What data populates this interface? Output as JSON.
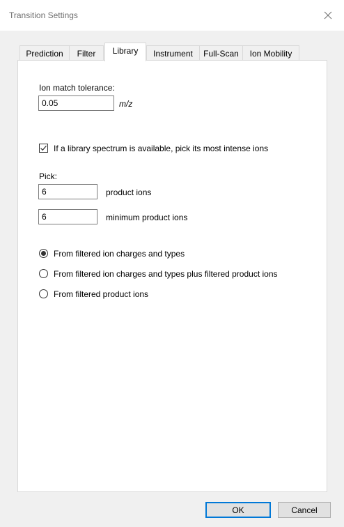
{
  "window": {
    "title": "Transition Settings"
  },
  "tabs": [
    {
      "label": "Prediction"
    },
    {
      "label": "Filter"
    },
    {
      "label": "Library"
    },
    {
      "label": "Instrument"
    },
    {
      "label": "Full-Scan"
    },
    {
      "label": "Ion Mobility"
    }
  ],
  "active_tab": "Library",
  "library": {
    "ion_match_tolerance_label": "Ion match tolerance:",
    "ion_match_tolerance_value": "0.05",
    "ion_match_tolerance_unit": "m/z",
    "pick_intense_checkbox_label": "If a library spectrum is available, pick its most intense ions",
    "pick_intense_checked": true,
    "pick_label": "Pick:",
    "product_ions_value": "6",
    "product_ions_label": "product ions",
    "min_product_ions_value": "6",
    "min_product_ions_label": "minimum product ions",
    "radio_options": [
      {
        "label": "From filtered ion charges and types",
        "selected": true
      },
      {
        "label": "From filtered ion charges and types plus filtered product ions",
        "selected": false
      },
      {
        "label": "From filtered product ions",
        "selected": false
      }
    ]
  },
  "buttons": {
    "ok_label": "OK",
    "cancel_label": "Cancel"
  },
  "colors": {
    "window_bg": "#f0f0f0",
    "page_bg": "#ffffff",
    "title_text": "#6d6d6d",
    "default_button_border": "#0078d7"
  }
}
